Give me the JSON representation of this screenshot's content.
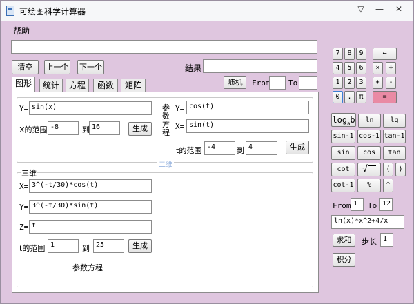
{
  "window": {
    "title": "可绘图科学计算器",
    "menu_help": "帮助"
  },
  "top": {
    "input_value": "",
    "clear": "清空",
    "prev": "上一个",
    "next": "下一个",
    "result_label": "结果",
    "result_value": "",
    "random": "随机",
    "from": "From",
    "from_value": "",
    "to": "To",
    "to_value": ""
  },
  "tabs": [
    "图形",
    "统计",
    "方程",
    "函数",
    "矩阵"
  ],
  "graph": {
    "y_label": "Y=",
    "y_value": "sin(x)",
    "x_range_label": "X的范围",
    "x_from": "-8",
    "to_label": "到",
    "x_to": "16",
    "generate": "生成",
    "param_title": "参数方程",
    "py_label": "Y=",
    "py_value": "cos(t)",
    "px_label": "X=",
    "px_value": "sin(t)",
    "t_range_label": "t的范围",
    "t_from": "-4",
    "t_to": "4",
    "legend_2d": "二维",
    "legend_3d": "三维",
    "x3_label": "X=",
    "x3_value": "3^(-t/30)*cos(t)",
    "y3_label": "Y=",
    "y3_value": "3^(-t/30)*sin(t)",
    "z3_label": "Z=",
    "z3_value": "t",
    "t3_range_label": "t的范围",
    "t3_from": "1",
    "t3_to": "25",
    "bottom_caption": "参数方程"
  },
  "keypad": {
    "digits": [
      "7",
      "8",
      "9",
      "4",
      "5",
      "6",
      "1",
      "2",
      "3",
      "0",
      ".",
      "π"
    ],
    "backspace": "←",
    "times": "×",
    "divide": "÷",
    "plus": "+",
    "minus": "-",
    "equals": "=",
    "equals_color": "#e98aa4",
    "func_keys": [
      "ln",
      "lg",
      "sin-1",
      "cos-1",
      "tan-1",
      "sin",
      "cos",
      "tan",
      "cot",
      "(",
      ")",
      "cot-1",
      "%",
      "^"
    ],
    "log_base": "log",
    "log_sub": "a",
    "log_b": "b",
    "sqrt": "√",
    "from": "From",
    "from_value": "1",
    "to": "To",
    "to_value": "12",
    "expr_value": "ln(x)*x^2+4/x",
    "sum": "求和",
    "step_label": "步长",
    "step_value": "1",
    "integral": "积分"
  }
}
